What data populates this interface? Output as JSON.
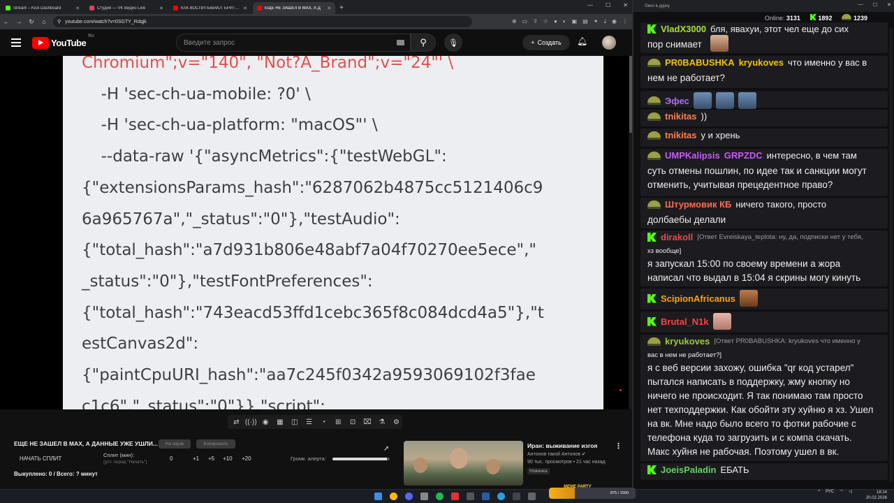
{
  "browser": {
    "tabs": [
      {
        "title": "Stream – Kick Dashboard",
        "color": "#53fc18"
      },
      {
        "title": "Студия — VK Видео Live",
        "color": "#e33d6e"
      },
      {
        "title": "КАК ВОСПИТЫВАЮТ БРИТАН",
        "color": "#ff0000"
      },
      {
        "title": "ЕЩЕ НЕ ЗАШЕЛ В MAX, А Д",
        "color": "#ff0000"
      }
    ],
    "url": "youtube.com/watch?v=0SGTY_Rdqjk"
  },
  "youtube": {
    "logo_text": "YouTube",
    "region": "RU",
    "search_placeholder": "Введите запрос",
    "create_label": "Создать"
  },
  "video": {
    "code_lines": [
      "Chromium\";v=\"140\", \"Not?A_Brand\";v=\"24\"' \\",
      "  -H 'sec-ch-ua-mobile: ?0' \\",
      "  -H 'sec-ch-ua-platform: \"macOS\"' \\",
      "  --data-raw '{\"asyncMetrics\":{\"testWebGL\":",
      "{\"extensionsParams_hash\":\"6287062b4875cc5121406c9",
      "6a965767a\",\"_status\":\"0\"},\"testAudio\":",
      "{\"total_hash\":\"a7d931b806e48abf7a04f70270ee5ece\",\"",
      "_status\":\"0\"},\"testFontPreferences\":",
      "{\"total_hash\":\"743eacd53ffd1cebc365f8c084dcd4a5\"},\"t",
      "estCanvas2d\":",
      "{\"paintCpuURI_hash\":\"aa7c245f0342a9593069102f3fae",
      "c1c6\",\"_status\":\"0\"}},\"script\":"
    ]
  },
  "panel": {
    "video_title": "ЕЩЕ НЕ ЗАШЕЛ В MAX, А ДАННЫЕ УЖЕ УШЛИ...",
    "pill_pause": "На паузе",
    "pill_copy": "Копировать",
    "start_split": "НАЧАТЬ СПЛИТ",
    "split_label": "Сплит (мин):",
    "split_sub": "(уст. перед \"Начать\")",
    "split_value": "0",
    "btn_1": "+1",
    "btn_5": "+5",
    "btn_10": "+10",
    "btn_20": "+20",
    "alert_volume": "Громк. алерта:",
    "alert_volume_level": 0.95,
    "bought": "Выкуплено: 0 / Всего: ? минут"
  },
  "recommended": {
    "title": "Иран: выживание изгоя",
    "channel": "Антонов такой Антонов",
    "meta": "90 тыс. просмотров • 21 час назад",
    "badge": "Новинка"
  },
  "chat": {
    "window_title": "Окно в дурку",
    "online_label": "Online:",
    "online": "3131",
    "kick_count": "1892",
    "helm_count": "1239",
    "messages": [
      {
        "user": "VladX3000",
        "color": "#a6e22e",
        "badge": "kick",
        "text": "бля, явахуи, этот чел еще до сих",
        "text2": "пор снимает"
      },
      {
        "user": "PR0BABUSHKA",
        "color": "#f1c40f",
        "badge": "helm",
        "mention": "kryukoves",
        "text": "что именно у вас в",
        "text2": "нем не работает?"
      },
      {
        "user": "Эфес",
        "color": "#b06cf0",
        "badge": "helm",
        "text": ""
      },
      {
        "user": "tnikitas",
        "color": "#ff7f50",
        "badge": "helm",
        "text": "))"
      },
      {
        "user": "tnikitas",
        "color": "#ff7f50",
        "badge": "helm",
        "text": "у и хрень"
      },
      {
        "user": "UMPKalipsis",
        "color": "#c65cf5",
        "badge": "helm",
        "mention": "GRPZDC",
        "text": "интересно, в чем там",
        "text2": "суть отмены пошлин, по идее так и санкции могут",
        "text3": "отменить, учитывая прецедентное право?"
      },
      {
        "user": "Штурмовик КБ",
        "color": "#ff6b4a",
        "badge": "helm",
        "text": "ничего такого, просто",
        "text2": "долбаебы делали"
      },
      {
        "user": "dirakoll",
        "color": "#e84a4a",
        "badge": "kick",
        "reply": "[Ответ Evreiskaya_teplota: ну, да, подписки нет у тебя,",
        "reply2": "хз вообще]",
        "text2": "я запускал 15:00 по своему времени а жора",
        "text3": "написал что выдал в 15:04 я скрины могу кинуть"
      },
      {
        "user": "ScipionAfricanus",
        "color": "#f7a21b",
        "badge": "kick",
        "text": ""
      },
      {
        "user": "Brutal_N1k",
        "color": "#ff4040",
        "badge": "kick",
        "text": ""
      },
      {
        "user": "kryukoves",
        "color": "#9acd32",
        "badge": "helm",
        "reply": "[Ответ PR0BABUSHKA: kryukoves что именно у",
        "reply2": "вас в нем не работает?]",
        "lines": [
          "я с веб версии захожу, ошибка \"qr код устарел\"",
          "пытался написать в поддержку, жму кнопку но",
          "ничего не происходит. Я так понимаю там просто",
          "нет техподдержки. Как обойти эту хуйню я хз. Ушел",
          "на вк. Мне надо было всего то фотки рабочие с",
          "телефона куда то загрузить и с компа скачать.",
          "Макс хуйня не рабочая. Поэтому ушел в вк."
        ]
      },
      {
        "user": "JoeisPaladin",
        "color": "#5fd35f",
        "badge": "kick",
        "text": "ЕБАТЬ"
      }
    ]
  },
  "taskbar": {
    "game_label": "MEME PARTY",
    "game_progress": "875 / 1500",
    "lang": "РУС",
    "time": "18:14",
    "date": "20.02.2026"
  }
}
